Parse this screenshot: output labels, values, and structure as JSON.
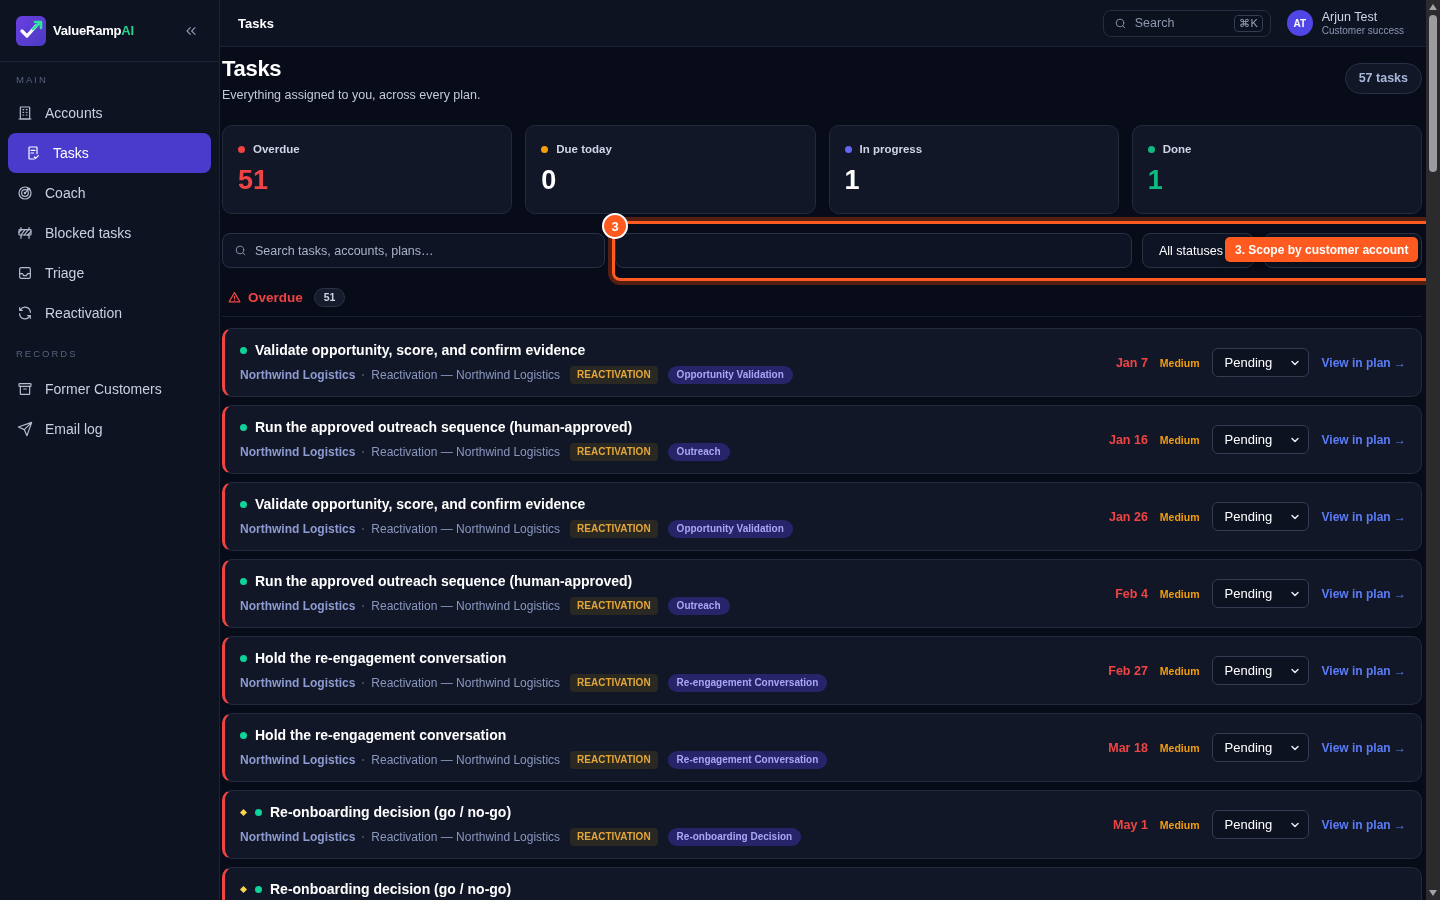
{
  "sidebar": {
    "brand": "ValueRamp",
    "brand_suffix": "AI",
    "sections": [
      {
        "title": "MAIN",
        "items": [
          {
            "label": "Accounts",
            "selected": false
          },
          {
            "label": "Tasks",
            "selected": true
          },
          {
            "label": "Coach",
            "selected": false
          },
          {
            "label": "Blocked tasks",
            "selected": false
          },
          {
            "label": "Triage",
            "selected": false
          },
          {
            "label": "Reactivation",
            "selected": false
          }
        ]
      },
      {
        "title": "RECORDS",
        "items": [
          {
            "label": "Former Customers",
            "selected": false
          },
          {
            "label": "Email log",
            "selected": false
          }
        ]
      }
    ]
  },
  "topbar": {
    "title": "Tasks",
    "search": {
      "placeholder": "Search",
      "shortcut": "⌘K"
    },
    "user": {
      "initials": "AT",
      "name": "Arjun Test",
      "role": "Customer success"
    }
  },
  "page": {
    "title": "Tasks",
    "subtitle": "Everything assigned to you, across every plan.",
    "count": "57 tasks"
  },
  "stats": [
    {
      "kind": "overdue",
      "label": "Overdue",
      "value": "51",
      "color": "#ef4444"
    },
    {
      "kind": "today",
      "label": "Due today",
      "value": "0",
      "color": "#f59e0b"
    },
    {
      "kind": "progress",
      "label": "In progress",
      "value": "1",
      "color": "#6366f1"
    },
    {
      "kind": "done",
      "label": "Done",
      "value": "1",
      "color": "#10b981"
    }
  ],
  "filters": [
    {
      "kind": "search",
      "placeholder": "Search tasks, accounts, plans…"
    },
    {
      "kind": "field"
    },
    {
      "kind": "select",
      "value": "All statuses"
    },
    {
      "kind": "select"
    }
  ],
  "tour": {
    "step": "3",
    "tooltip": "3. Scope by customer account"
  },
  "sections": [
    {
      "kind": "overdue",
      "title": "Overdue",
      "count": "51",
      "tasks": [
        {
          "title": "Validate opportunity, score, and confirm evidence",
          "decision": false,
          "account": "Northwind Logistics",
          "plan": "Reactivation — Northwind Logistics",
          "tag": "REACTIVATION",
          "category": "Opportunity Validation",
          "due": "Jan 7",
          "priority": "Medium",
          "status": "Pending",
          "link": "View in plan →"
        },
        {
          "title": "Run the approved outreach sequence (human-approved)",
          "decision": false,
          "account": "Northwind Logistics",
          "plan": "Reactivation — Northwind Logistics",
          "tag": "REACTIVATION",
          "category": "Outreach",
          "due": "Jan 16",
          "priority": "Medium",
          "status": "Pending",
          "link": "View in plan →"
        },
        {
          "title": "Validate opportunity, score, and confirm evidence",
          "decision": false,
          "account": "Northwind Logistics",
          "plan": "Reactivation — Northwind Logistics",
          "tag": "REACTIVATION",
          "category": "Opportunity Validation",
          "due": "Jan 26",
          "priority": "Medium",
          "status": "Pending",
          "link": "View in plan →"
        },
        {
          "title": "Run the approved outreach sequence (human-approved)",
          "decision": false,
          "account": "Northwind Logistics",
          "plan": "Reactivation — Northwind Logistics",
          "tag": "REACTIVATION",
          "category": "Outreach",
          "due": "Feb 4",
          "priority": "Medium",
          "status": "Pending",
          "link": "View in plan →"
        },
        {
          "title": "Hold the re-engagement conversation",
          "decision": false,
          "account": "Northwind Logistics",
          "plan": "Reactivation — Northwind Logistics",
          "tag": "REACTIVATION",
          "category": "Re-engagement Conversation",
          "due": "Feb 27",
          "priority": "Medium",
          "status": "Pending",
          "link": "View in plan →"
        },
        {
          "title": "Hold the re-engagement conversation",
          "decision": false,
          "account": "Northwind Logistics",
          "plan": "Reactivation — Northwind Logistics",
          "tag": "REACTIVATION",
          "category": "Re-engagement Conversation",
          "due": "Mar 18",
          "priority": "Medium",
          "status": "Pending",
          "link": "View in plan →"
        },
        {
          "title": "Re-onboarding decision (go / no-go)",
          "decision": true,
          "account": "Northwind Logistics",
          "plan": "Reactivation — Northwind Logistics",
          "tag": "REACTIVATION",
          "category": "Re-onboarding Decision",
          "due": "May 1",
          "priority": "Medium",
          "status": "Pending",
          "link": "View in plan →"
        },
        {
          "title": "Re-onboarding decision (go / no-go)",
          "decision": true
        }
      ]
    }
  ]
}
